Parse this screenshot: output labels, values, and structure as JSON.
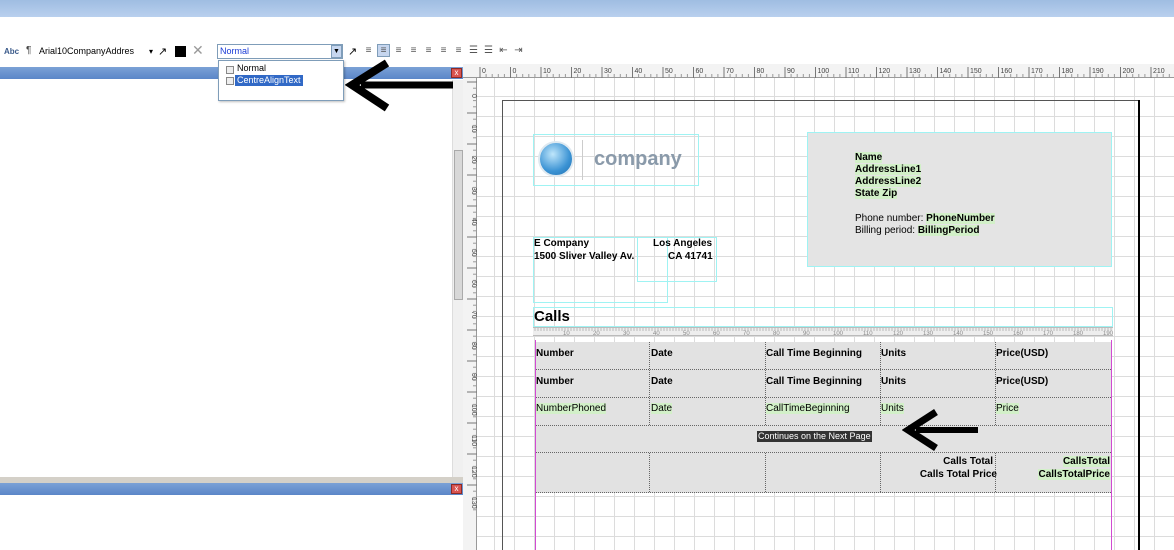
{
  "toolbar": {
    "abc_label": "Abc",
    "pilcrow": "¶",
    "font_name": "Arial10CompanyAddres",
    "style_value": "Normal"
  },
  "style_dropdown": {
    "options": [
      "Normal",
      "CentreAlignText"
    ],
    "highlighted": "CentreAlignText"
  },
  "panel": {
    "close_glyph": "x"
  },
  "rulers": {
    "top_ticks": [
      "0",
      "0",
      "10",
      "20",
      "30",
      "40",
      "50",
      "60",
      "70",
      "80",
      "90",
      "100",
      "110",
      "120",
      "130",
      "140",
      "150",
      "160",
      "170",
      "180",
      "190",
      "200",
      "210",
      "22"
    ],
    "left_ticks": [
      "0",
      "10",
      "20",
      "30",
      "40",
      "50",
      "60",
      "70",
      "80",
      "90",
      "100",
      "110",
      "120",
      "130"
    ],
    "mini_ticks": [
      "10",
      "20",
      "30",
      "40",
      "50",
      "60",
      "70",
      "80",
      "90",
      "100",
      "110",
      "120",
      "130",
      "140",
      "150",
      "160",
      "170",
      "180",
      "190"
    ]
  },
  "report": {
    "logo_text": "company",
    "address": {
      "name": "Name",
      "line1": "AddressLine1",
      "line2": "AddressLine2",
      "state_zip": "State Zip",
      "phone_label": "Phone number: ",
      "phone_field": "PhoneNumber",
      "billing_label": "Billing period: ",
      "billing_field": "BillingPeriod"
    },
    "company": {
      "name": "E Company",
      "street": "1500 Sliver Valley Av.",
      "city": "Los Angeles",
      "state_zip": "CA 41741"
    },
    "section_title": "Calls",
    "columns": [
      "Number",
      "Date",
      "Call Time Beginning",
      "Units",
      "Price(USD)"
    ],
    "data_fields": [
      "NumberPhoned",
      "Date",
      "CallTimeBeginning",
      "Units",
      "Price"
    ],
    "continues_text": "Continues on the Next Page",
    "totals": {
      "label1": "Calls Total",
      "label2": "Calls Total Price",
      "field1": "CallsTotal",
      "field2": "CallsTotalPrice"
    }
  }
}
